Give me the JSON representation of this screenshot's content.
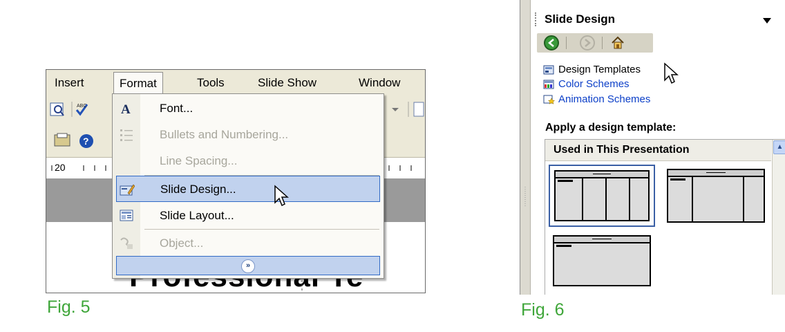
{
  "fig5": {
    "menubar": [
      "Insert",
      "Format",
      "Tools",
      "Slide Show",
      "Window"
    ],
    "ruler_label": "20",
    "menu": {
      "items": [
        {
          "label": "Font...",
          "icon": "font-icon",
          "disabled": false,
          "highlighted": false
        },
        {
          "label": "Bullets and Numbering...",
          "icon": "bullets-icon",
          "disabled": true,
          "highlighted": false
        },
        {
          "label": "Line Spacing...",
          "icon": "none",
          "disabled": true,
          "highlighted": false
        },
        {
          "label": "Slide Design...",
          "icon": "slide-design-icon",
          "disabled": false,
          "highlighted": true
        },
        {
          "label": "Slide Layout...",
          "icon": "slide-layout-icon",
          "disabled": false,
          "highlighted": false
        },
        {
          "label": "Object...",
          "icon": "object-icon",
          "disabled": true,
          "highlighted": false
        }
      ],
      "expand_icon": "chevron-double-down-icon"
    },
    "slide_title_text": "Professional Te",
    "caption": "Fig. 5"
  },
  "fig6": {
    "pane_title": "Slide Design",
    "nav_icons": [
      "back-icon",
      "forward-icon",
      "home-icon"
    ],
    "links": [
      {
        "label": "Design Templates",
        "icon": "design-templates-icon",
        "color": "#000000"
      },
      {
        "label": "Color Schemes",
        "icon": "color-schemes-icon",
        "color": "#0b3fc8"
      },
      {
        "label": "Animation Schemes",
        "icon": "animation-schemes-icon",
        "color": "#0b3fc8"
      }
    ],
    "apply_label": "Apply a design template:",
    "gallery_header": "Used in This Presentation",
    "caption": "Fig. 6"
  },
  "colors": {
    "caption": "#3fa63a",
    "menu_highlight": "#c1d2ee",
    "menu_highlight_border": "#316ac5",
    "link_blue": "#0b3fc8"
  }
}
